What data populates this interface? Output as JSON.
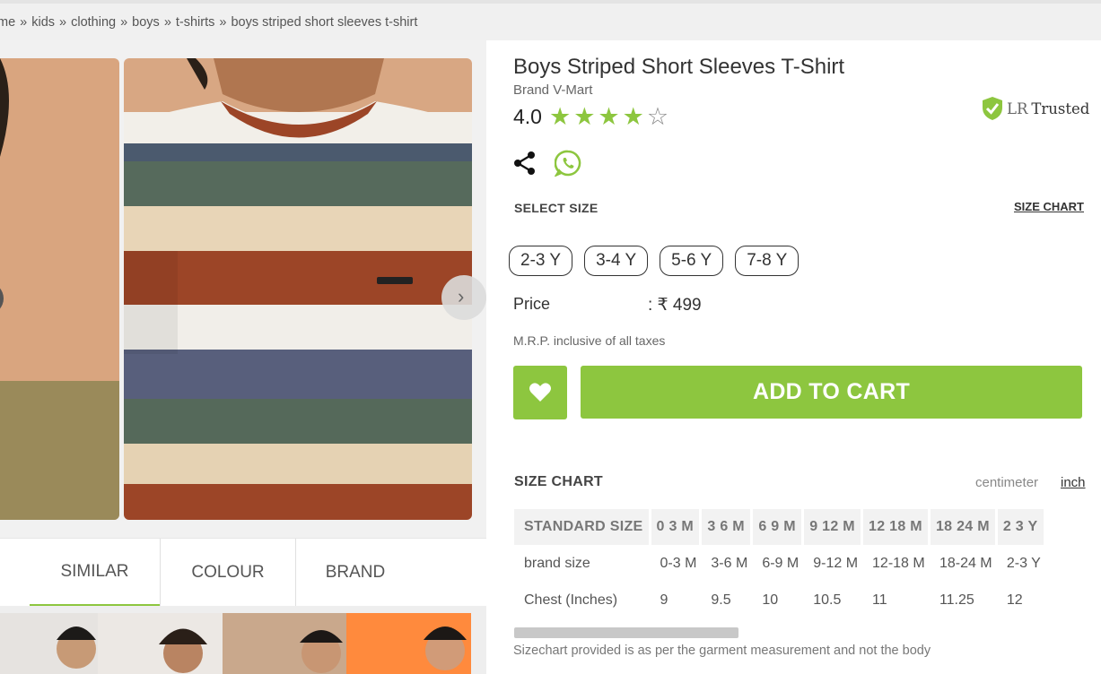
{
  "breadcrumb": [
    "me",
    "kids",
    "clothing",
    "boys",
    "t-shirts",
    "boys striped short sleeves t-shirt"
  ],
  "product": {
    "title": "Boys Striped Short Sleeves T-Shirt",
    "brand": "Brand V-Mart",
    "rating": "4.0",
    "stars_filled": 4,
    "stars_total": 5,
    "trusted_prefix": "LR",
    "trusted_label": "Trusted"
  },
  "icons": {
    "share": "share-icon",
    "whatsapp": "whatsapp-icon",
    "wishlist": "heart-icon",
    "trusted": "shield-check-icon"
  },
  "size_section": {
    "label": "SELECT SIZE",
    "chart_link": "SIZE CHART",
    "sizes": [
      "2-3 Y",
      "3-4 Y",
      "5-6 Y",
      "7-8 Y"
    ]
  },
  "price": {
    "label": "Price",
    "value": ": ₹ 499",
    "mrp_note": "M.R.P. inclusive of all taxes"
  },
  "cart": {
    "button": "ADD TO CART"
  },
  "size_chart": {
    "title": "SIZE CHART",
    "unit_cm": "centimeter",
    "unit_in": "inch",
    "headers": [
      "STANDARD SIZE",
      "0 3 M",
      "3 6 M",
      "6 9 M",
      "9 12 M",
      "12 18 M",
      "18 24 M",
      "2 3 Y"
    ],
    "rows": [
      [
        "brand size",
        "0-3 M",
        "3-6 M",
        "6-9 M",
        "9-12 M",
        "12-18 M",
        "18-24 M",
        "2-3 Y"
      ],
      [
        "Chest (Inches)",
        "9",
        "9.5",
        "10",
        "10.5",
        "11",
        "11.25",
        "12"
      ]
    ],
    "note": "Sizechart provided is as per the garment measurement and not the body"
  },
  "tabs": [
    "SIMILAR",
    "COLOUR",
    "BRAND"
  ],
  "colors": {
    "accent": "#8dc63f",
    "text": "#333333"
  }
}
